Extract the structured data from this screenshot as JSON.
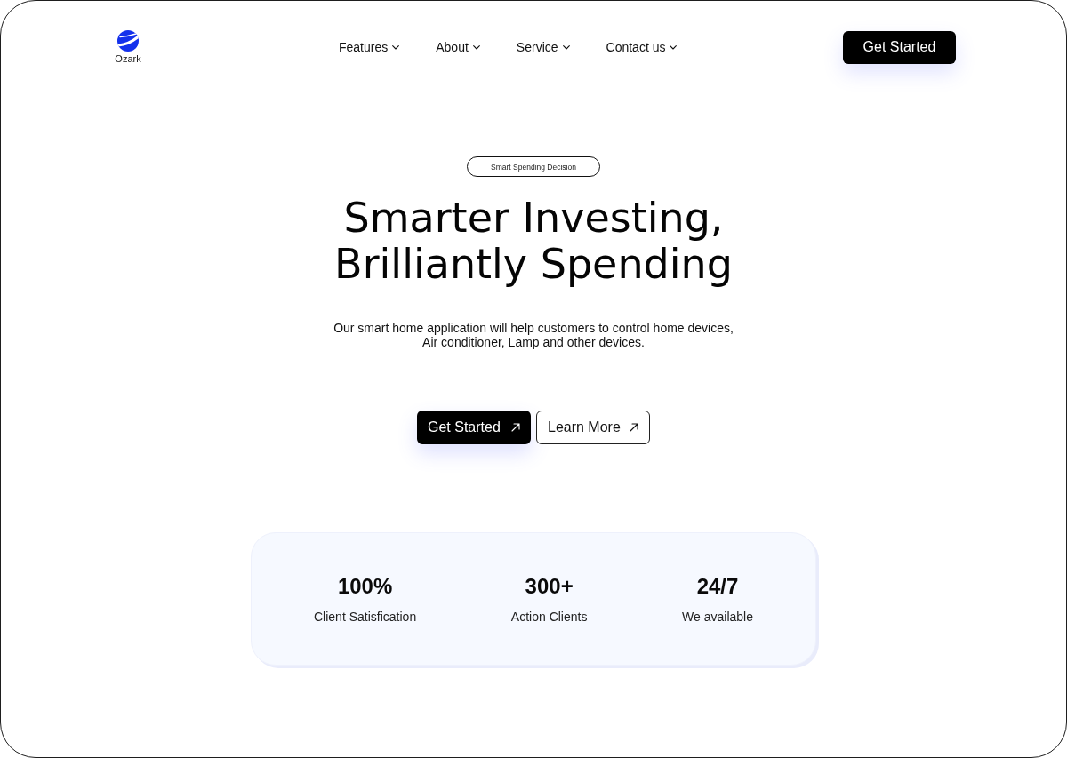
{
  "header": {
    "logo": {
      "name": "Ozark"
    },
    "nav": [
      {
        "label": "Features"
      },
      {
        "label": "About"
      },
      {
        "label": "Service"
      },
      {
        "label": "Contact us"
      }
    ],
    "cta": {
      "label": "Get Started"
    }
  },
  "hero": {
    "badge": "Smart Spending Decision",
    "title_lines": [
      "Smarter Investing,",
      "Brilliantly Spending"
    ],
    "description_lines": [
      "Our smart home application will help customers to control home devices,",
      "Air conditioner, Lamp and other devices."
    ],
    "buttons": [
      {
        "label": "Get Started",
        "kind": "primary"
      },
      {
        "label": "Learn More",
        "kind": "outline"
      }
    ]
  },
  "stats": [
    {
      "value": "100%",
      "label": "Client Satisfication"
    },
    {
      "value": "300+",
      "label": "Action Clients"
    },
    {
      "value": "24/7",
      "label": "We available"
    }
  ]
}
